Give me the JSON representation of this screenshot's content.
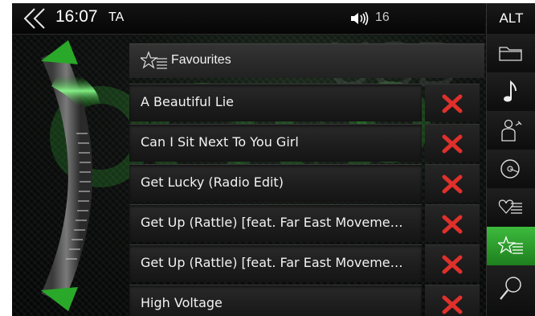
{
  "header": {
    "clock": "16:07",
    "traffic": "TA",
    "volume": "16",
    "alt_label": "ALT"
  },
  "source_watermark": "USB",
  "list": {
    "header_label": "Favourites",
    "items": [
      {
        "title": "A Beautiful Lie"
      },
      {
        "title": "Can I Sit Next To You Girl"
      },
      {
        "title": "Get Lucky (Radio Edit)"
      },
      {
        "title": "Get Up (Rattle) [feat. Far East Moveme…"
      },
      {
        "title": "Get Up (Rattle) [feat. Far East Moveme…"
      },
      {
        "title": "High Voltage"
      }
    ]
  },
  "sidebar": {
    "items": [
      {
        "icon": "folder-icon"
      },
      {
        "icon": "music-note-icon"
      },
      {
        "icon": "artist-icon"
      },
      {
        "icon": "album-icon"
      },
      {
        "icon": "heart-list-icon"
      },
      {
        "icon": "star-list-icon",
        "active": true
      },
      {
        "icon": "search-icon"
      }
    ]
  },
  "colors": {
    "accent_green": "#2fa82f",
    "delete_red": "#e0302a",
    "background": "#0c0f0d"
  }
}
